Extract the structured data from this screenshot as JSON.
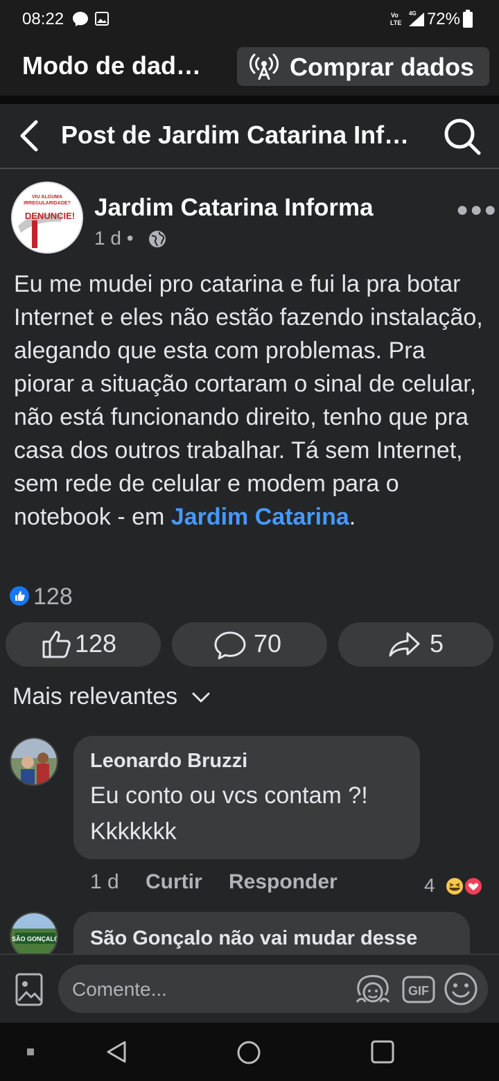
{
  "status_bar": {
    "time": "08:22",
    "battery": "72%",
    "network": "4G",
    "volte": "Vo LTE"
  },
  "data_banner": {
    "title": "Modo de dados gratuito",
    "buy_label": "Comprar dados"
  },
  "header": {
    "title": "Post de Jardim Catarina Informa"
  },
  "post": {
    "page_name": "Jardim Catarina Informa",
    "time": "1 d",
    "avatar_text": {
      "line1": "VIU ALGUMA",
      "line2": "IRREGULARIDADE?",
      "line3": "DENUNCIE!"
    },
    "text": "Eu me mudei pro catarina e fui la pra botar Internet e eles não estão fazendo instalação, alegando que esta com problemas. Pra piorar a situação cortaram o sinal de celular,  não está funcionando direito, tenho que pra casa dos outros trabalhar. Tá sem Internet,  sem rede de celular e modem para o notebook - em ",
    "location": "Jardim Catarina",
    "text_end": ".",
    "reaction_count": "128",
    "like_count": "128",
    "comment_count": "70",
    "share_count": "5"
  },
  "sort": {
    "label": "Mais relevantes"
  },
  "comments": [
    {
      "author": "Leonardo Bruzzi",
      "text_line1": "Eu conto ou vcs contam ?!",
      "text_line2": "Kkkkkkk",
      "time": "1 d",
      "like_label": "Curtir",
      "reply_label": "Responder",
      "reaction_count": "4"
    },
    {
      "author": "São Gonçalo não vai mudar desse",
      "avatar_text": "SÃO GONÇALO"
    }
  ],
  "comment_input": {
    "placeholder": "Comente..."
  },
  "colors": {
    "background": "#242526",
    "bubble": "#3a3b3c",
    "link": "#4599ff",
    "like_blue": "#1877f2"
  }
}
